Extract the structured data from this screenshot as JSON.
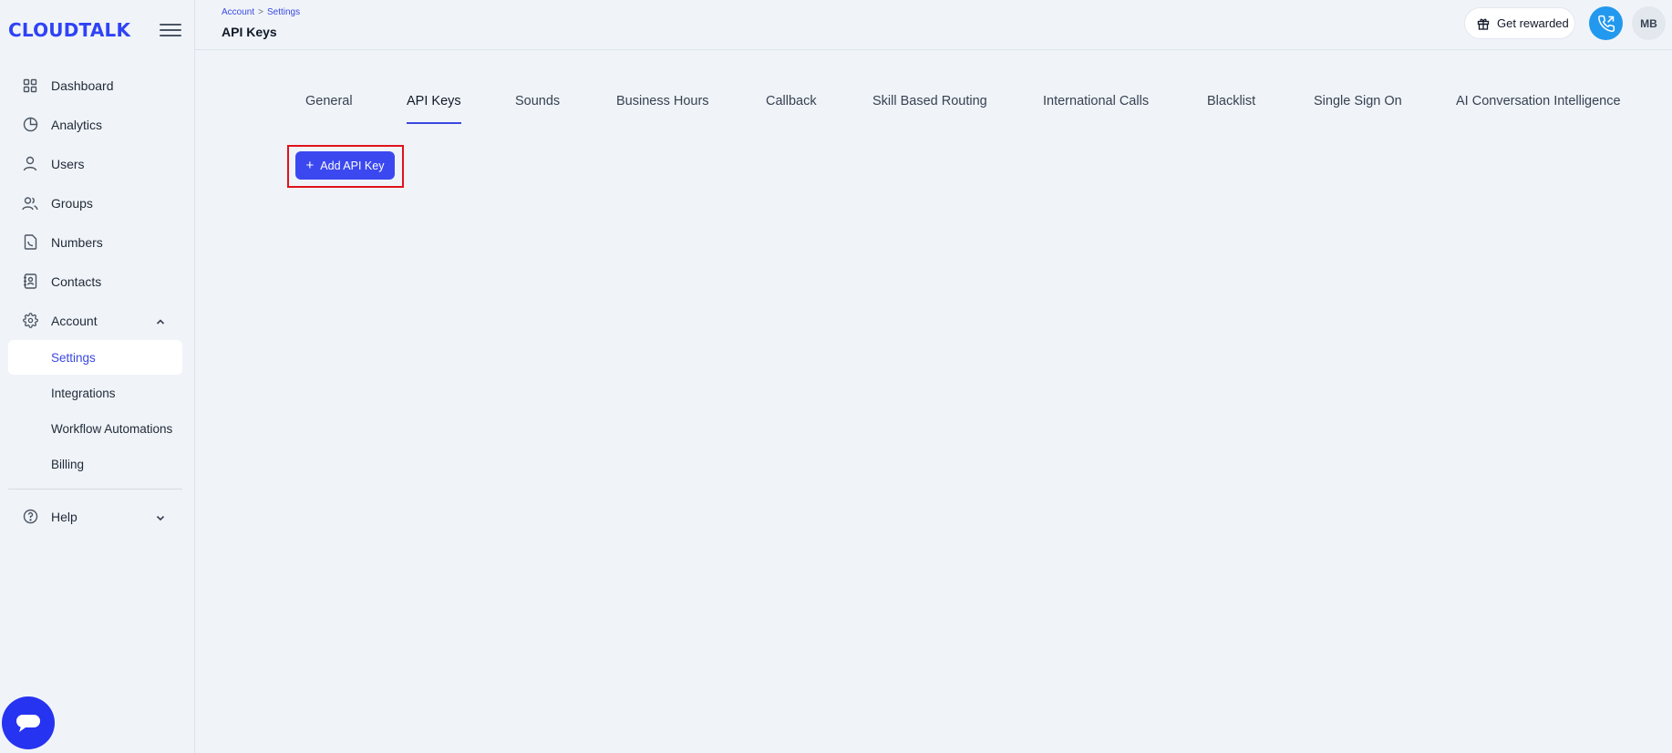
{
  "brand": {
    "logo": "CLOUDTALK"
  },
  "sidebar": {
    "items": [
      {
        "label": "Dashboard",
        "icon": "grid-icon"
      },
      {
        "label": "Analytics",
        "icon": "pie-chart-icon"
      },
      {
        "label": "Users",
        "icon": "user-icon"
      },
      {
        "label": "Groups",
        "icon": "users-icon"
      },
      {
        "label": "Numbers",
        "icon": "phone-document-icon"
      },
      {
        "label": "Contacts",
        "icon": "contact-book-icon"
      },
      {
        "label": "Account",
        "icon": "gear-icon",
        "expanded": true
      }
    ],
    "account_sub": [
      {
        "label": "Settings",
        "active": true
      },
      {
        "label": "Integrations"
      },
      {
        "label": "Workflow Automations"
      },
      {
        "label": "Billing"
      }
    ],
    "help": {
      "label": "Help",
      "icon": "help-circle-icon"
    }
  },
  "header": {
    "breadcrumb": [
      "Account",
      "Settings"
    ],
    "breadcrumb_sep": ">",
    "title": "API Keys",
    "rewarded_label": "Get rewarded",
    "avatar_initials": "MB"
  },
  "tabs": [
    {
      "label": "General"
    },
    {
      "label": "API Keys",
      "active": true
    },
    {
      "label": "Sounds"
    },
    {
      "label": "Business Hours"
    },
    {
      "label": "Callback"
    },
    {
      "label": "Skill Based Routing"
    },
    {
      "label": "International Calls"
    },
    {
      "label": "Blacklist"
    },
    {
      "label": "Single Sign On"
    },
    {
      "label": "AI Conversation Intelligence"
    }
  ],
  "main": {
    "add_button_label": "Add API Key"
  },
  "colors": {
    "brand": "#2f43f5",
    "accent": "#3b48e0",
    "highlight": "#e0121b",
    "call": "#2299ee"
  }
}
